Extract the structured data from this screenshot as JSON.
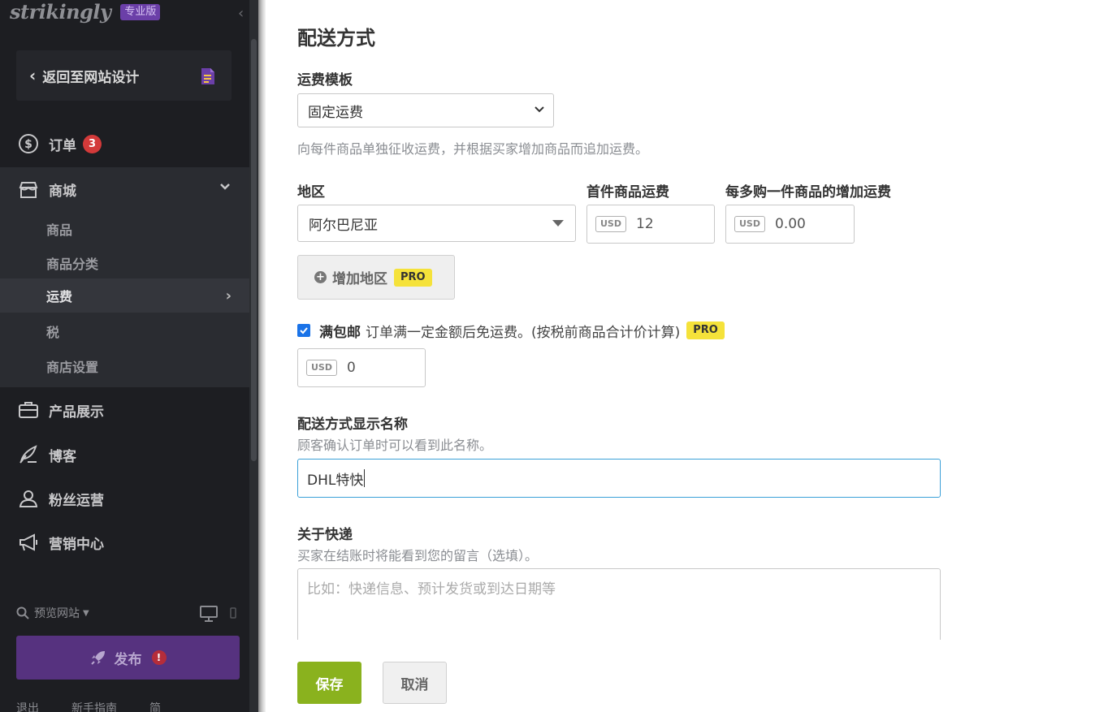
{
  "sidebar": {
    "logo": "strikingly",
    "plan_badge": "专业版",
    "back_label": "返回至网站设计",
    "nav": {
      "orders": {
        "label": "订单",
        "count": "3"
      },
      "shop": {
        "label": "商城"
      },
      "products_showcase": {
        "label": "产品展示"
      },
      "blog": {
        "label": "博客"
      },
      "fans": {
        "label": "粉丝运营"
      },
      "marketing": {
        "label": "营销中心"
      }
    },
    "shop_sub": {
      "products": "商品",
      "categories": "商品分类",
      "shipping": "运费",
      "tax": "税",
      "store_settings": "商店设置"
    },
    "preview_label": "预览网站",
    "publish_label": "发布",
    "publish_warning": "!",
    "footer": [
      "退出",
      "新手指南",
      "简"
    ],
    "colors": {
      "bg": "#1d1e22",
      "publish": "#56327f",
      "badge": "#d33a3a"
    }
  },
  "main": {
    "title": "配送方式",
    "template_label": "运费模板",
    "template_value": "固定运费",
    "template_hint": "向每件商品单独征收运费，并根据买家增加商品而追加运费。",
    "region_label": "地区",
    "region_value": "阿尔巴尼亚",
    "first_item_label": "首件商品运费",
    "first_item_currency": "USD",
    "first_item_value": "12",
    "additional_label": "每多购一件商品的增加运费",
    "additional_currency": "USD",
    "additional_value": "0.00",
    "add_region_label": "增加地区",
    "pro_badge": "PRO",
    "free_ship_checked": true,
    "free_ship_title": "满包邮",
    "free_ship_desc": "订单满一定金额后免运费。(按税前商品合计价计算)",
    "free_ship_currency": "USD",
    "free_ship_value": "0",
    "display_name_label": "配送方式显示名称",
    "display_name_hint": "顾客确认订单时可以看到此名称。",
    "display_name_value": "DHL特快",
    "about_label": "关于快递",
    "about_hint": "买家在结账时将能看到您的留言（选填）。",
    "about_placeholder": "比如：快递信息、预计发货或到达日期等",
    "save_label": "保存",
    "cancel_label": "取消",
    "colors": {
      "save": "#8ab21e",
      "focus_border": "#3aa0d8",
      "checkbox": "#1a73e8",
      "pro": "#f5e23a"
    }
  }
}
